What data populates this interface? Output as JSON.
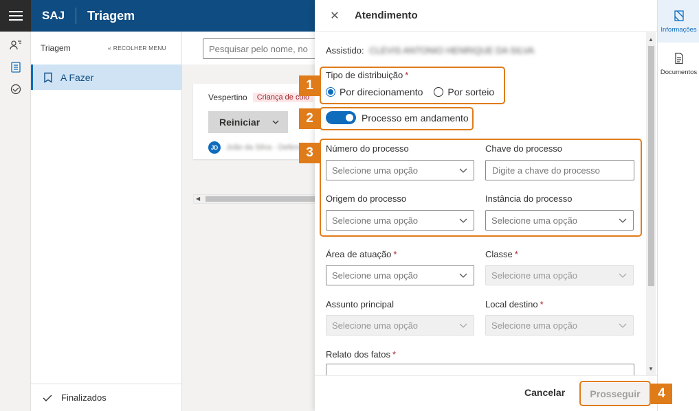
{
  "topbar": {
    "brand": "SAJ",
    "title": "Triagem"
  },
  "sidebar": {
    "title": "Triagem",
    "collapse_label": "RECOLHER MENU",
    "items": [
      {
        "label": "A Fazer"
      }
    ],
    "footer": {
      "label": "Finalizados"
    }
  },
  "main": {
    "search": {
      "placeholder": "Pesquisar pelo nome, no"
    },
    "card": {
      "period": "Vespertino",
      "tag": "Criança de colo",
      "button": "Reiniciar",
      "user_initials": "JD",
      "user_name": "João da Silva - Defensor"
    }
  },
  "right_rail": {
    "items": [
      {
        "label": "Informações"
      },
      {
        "label": "Documentos"
      }
    ]
  },
  "panel": {
    "title": "Atendimento",
    "assistido": {
      "label": "Assistido:",
      "value": "CLEVIS ANTONIO HENRIQUE DA SILVA"
    },
    "distribution": {
      "label": "Tipo de distribuição",
      "options": [
        {
          "label": "Por direcionamento",
          "checked": true
        },
        {
          "label": "Por sorteio",
          "checked": false
        }
      ]
    },
    "toggle": {
      "label": "Processo em andamento",
      "on": true
    },
    "fields": {
      "numero": {
        "label": "Número do processo",
        "placeholder": "Selecione uma opção"
      },
      "chave": {
        "label": "Chave do processo",
        "placeholder": "Digite a chave do processo"
      },
      "origem": {
        "label": "Origem do processo",
        "placeholder": "Selecione uma opção"
      },
      "instancia": {
        "label": "Instância do processo",
        "placeholder": "Selecione uma opção"
      },
      "area": {
        "label": "Área de atuação",
        "placeholder": "Selecione uma opção"
      },
      "classe": {
        "label": "Classe",
        "placeholder": "Selecione uma opção"
      },
      "assunto": {
        "label": "Assunto principal",
        "placeholder": "Selecione uma opção"
      },
      "local": {
        "label": "Local destino",
        "placeholder": "Selecione uma opção"
      },
      "relato": {
        "label": "Relato dos fatos"
      }
    },
    "footer": {
      "cancel": "Cancelar",
      "proceed": "Prosseguir"
    }
  },
  "callouts": [
    "1",
    "2",
    "3",
    "4"
  ],
  "colors": {
    "primary": "#0f4c81",
    "accent": "#0f6cbd",
    "callout": "#e07b1a",
    "required": "#a4262c"
  }
}
